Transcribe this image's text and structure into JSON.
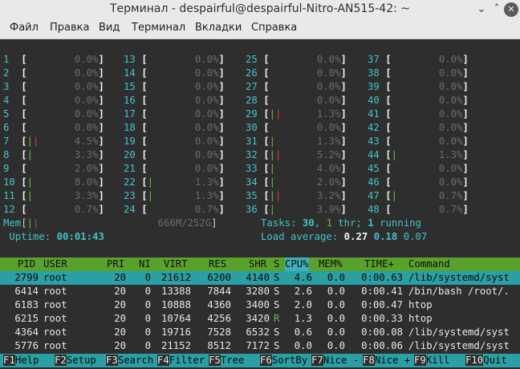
{
  "window": {
    "title": "Терминал - despairful@despairful-Nitro-AN515-42: ~",
    "buttons": [
      "⌄",
      "˄",
      "✕"
    ]
  },
  "menubar": [
    "Файл",
    "Правка",
    "Вид",
    "Терминал",
    "Вкладки",
    "Справка"
  ],
  "cpu_meters": [
    {
      "id": "1",
      "bar": "",
      "pct": "0.0%"
    },
    {
      "id": "2",
      "bar": "",
      "pct": "0.0%"
    },
    {
      "id": "3",
      "bar": "",
      "pct": "0.0%"
    },
    {
      "id": "4",
      "bar": "",
      "pct": "0.0%"
    },
    {
      "id": "5",
      "bar": "",
      "pct": "0.0%"
    },
    {
      "id": "6",
      "bar": "",
      "pct": "0.0%"
    },
    {
      "id": "7",
      "bar": "||",
      "pct": "4.5%"
    },
    {
      "id": "8",
      "bar": "|",
      "pct": "3.3%"
    },
    {
      "id": "9",
      "bar": "",
      "pct": "2.0%"
    },
    {
      "id": "10",
      "bar": "|",
      "pct": "8.0%"
    },
    {
      "id": "11",
      "bar": "|",
      "pct": "3.3%"
    },
    {
      "id": "12",
      "bar": "",
      "pct": "0.7%"
    },
    {
      "id": "13",
      "bar": "",
      "pct": "0.0%"
    },
    {
      "id": "14",
      "bar": "",
      "pct": "0.0%"
    },
    {
      "id": "15",
      "bar": "",
      "pct": "0.0%"
    },
    {
      "id": "16",
      "bar": "",
      "pct": "0.0%"
    },
    {
      "id": "17",
      "bar": "",
      "pct": "0.0%"
    },
    {
      "id": "18",
      "bar": "",
      "pct": "0.0%"
    },
    {
      "id": "19",
      "bar": "",
      "pct": "0.0%"
    },
    {
      "id": "20",
      "bar": "",
      "pct": "0.0%"
    },
    {
      "id": "21",
      "bar": "",
      "pct": "0.0%"
    },
    {
      "id": "22",
      "bar": "|",
      "pct": "1.3%"
    },
    {
      "id": "23",
      "bar": "|",
      "pct": "1.3%"
    },
    {
      "id": "24",
      "bar": "",
      "pct": "0.7%"
    },
    {
      "id": "25",
      "bar": "",
      "pct": "0.0%"
    },
    {
      "id": "26",
      "bar": "",
      "pct": "0.0%"
    },
    {
      "id": "27",
      "bar": "",
      "pct": "0.0%"
    },
    {
      "id": "28",
      "bar": "",
      "pct": "0.0%"
    },
    {
      "id": "29",
      "bar": "||",
      "pct": "1.3%"
    },
    {
      "id": "30",
      "bar": "",
      "pct": "0.0%"
    },
    {
      "id": "31",
      "bar": "|",
      "pct": "1.3%"
    },
    {
      "id": "32",
      "bar": "||",
      "pct": "5.2%"
    },
    {
      "id": "33",
      "bar": "|",
      "pct": "4.0%"
    },
    {
      "id": "34",
      "bar": "|",
      "pct": "2.0%"
    },
    {
      "id": "35",
      "bar": "||",
      "pct": "3.2%"
    },
    {
      "id": "36",
      "bar": "|",
      "pct": "3.9%"
    },
    {
      "id": "37",
      "bar": "",
      "pct": "0.0%"
    },
    {
      "id": "38",
      "bar": "",
      "pct": "0.0%"
    },
    {
      "id": "39",
      "bar": "",
      "pct": "0.0%"
    },
    {
      "id": "40",
      "bar": "",
      "pct": "0.0%"
    },
    {
      "id": "41",
      "bar": "",
      "pct": "0.0%"
    },
    {
      "id": "42",
      "bar": "",
      "pct": "0.0%"
    },
    {
      "id": "43",
      "bar": "",
      "pct": "0.0%"
    },
    {
      "id": "44",
      "bar": "|",
      "pct": "1.3%"
    },
    {
      "id": "45",
      "bar": "",
      "pct": "0.0%"
    },
    {
      "id": "46",
      "bar": "",
      "pct": "0.0%"
    },
    {
      "id": "47",
      "bar": "|",
      "pct": "0.7%"
    },
    {
      "id": "48",
      "bar": "",
      "pct": "0.7%"
    }
  ],
  "memory": {
    "label": "Mem",
    "value": "666M/252G"
  },
  "uptime": {
    "label": "Uptime:",
    "value": "00:01:43"
  },
  "tasks": {
    "label": "Tasks:",
    "count": "30",
    "thr": "1",
    "thr_label": "thr;",
    "running": "1",
    "running_label": "running"
  },
  "load": {
    "label": "Load average:",
    "v1": "0.27",
    "v5": "0.18",
    "v15": "0.07"
  },
  "columns": [
    "PID",
    "USER",
    "PRI",
    "NI",
    "VIRT",
    "RES",
    "SHR",
    "S",
    "CPU%",
    "MEM%",
    "TIME+",
    "Command"
  ],
  "processes": [
    {
      "pid": "2799",
      "user": "root",
      "pri": "20",
      "ni": "0",
      "virt": "21612",
      "res": "6200",
      "shr": "4140",
      "s": "S",
      "cpu": "4.6",
      "mem": "0.0",
      "time": "0:00.63",
      "cmd": "/lib/systemd/syst"
    },
    {
      "pid": "6414",
      "user": "root",
      "pri": "20",
      "ni": "0",
      "virt": "13388",
      "res": "7844",
      "shr": "3280",
      "s": "S",
      "cpu": "2.6",
      "mem": "0.0",
      "time": "0:00.41",
      "cmd": "/bin/bash /root/."
    },
    {
      "pid": "6183",
      "user": "root",
      "pri": "20",
      "ni": "0",
      "virt": "10888",
      "res": "4360",
      "shr": "3400",
      "s": "S",
      "cpu": "2.0",
      "mem": "0.0",
      "time": "0:00.47",
      "cmd": "htop"
    },
    {
      "pid": "6215",
      "user": "root",
      "pri": "20",
      "ni": "0",
      "virt": "10764",
      "res": "4256",
      "shr": "3420",
      "s": "R",
      "cpu": "1.3",
      "mem": "0.0",
      "time": "0:00.33",
      "cmd": "htop"
    },
    {
      "pid": "4364",
      "user": "root",
      "pri": "20",
      "ni": "0",
      "virt": "19716",
      "res": "7528",
      "shr": "6532",
      "s": "S",
      "cpu": "0.6",
      "mem": "0.0",
      "time": "0:00.08",
      "cmd": "/lib/systemd/syst"
    },
    {
      "pid": "5776",
      "user": "root",
      "pri": "20",
      "ni": "0",
      "virt": "21152",
      "res": "8512",
      "shr": "7172",
      "s": "S",
      "cpu": "0.0",
      "mem": "0.0",
      "time": "0:00.06",
      "cmd": "/lib/systemd/syst"
    }
  ],
  "function_keys": [
    {
      "key": "F1",
      "label": "Help  "
    },
    {
      "key": "F2",
      "label": "Setup "
    },
    {
      "key": "F3",
      "label": "Search"
    },
    {
      "key": "F4",
      "label": "Filter"
    },
    {
      "key": "F5",
      "label": "Tree  "
    },
    {
      "key": "F6",
      "label": "SortBy"
    },
    {
      "key": "F7",
      "label": "Nice -"
    },
    {
      "key": "F8",
      "label": "Nice +"
    },
    {
      "key": "F9",
      "label": "Kill  "
    },
    {
      "key": "F10",
      "label": "Quit"
    }
  ]
}
